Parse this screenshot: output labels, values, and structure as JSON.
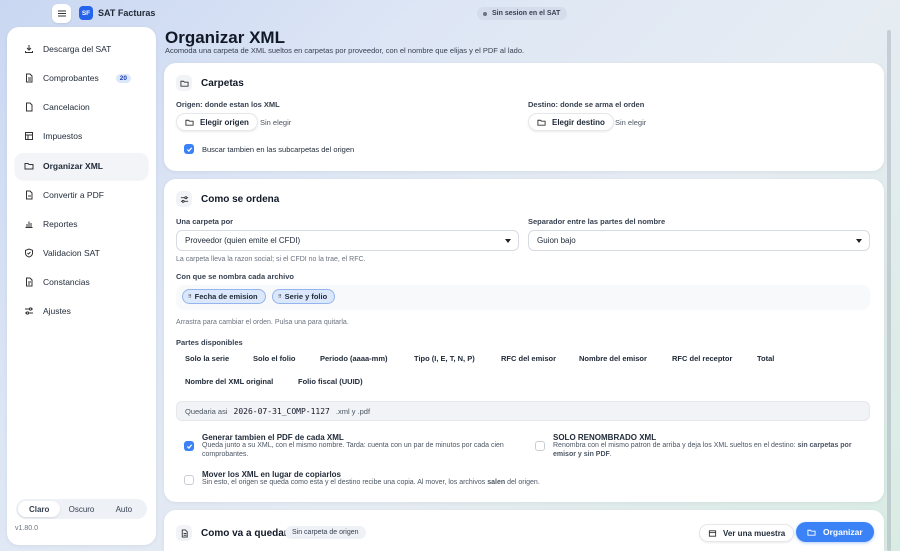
{
  "app": {
    "title": "SAT Facturas",
    "logo": "SF",
    "session": "Sin sesion en el SAT"
  },
  "sidebar": {
    "items": [
      {
        "label": "Descarga del SAT",
        "icon": "download-icon"
      },
      {
        "label": "Comprobantes",
        "icon": "document-icon",
        "badge": "20"
      },
      {
        "label": "Cancelacion",
        "icon": "cancel-icon"
      },
      {
        "label": "Impuestos",
        "icon": "table-icon"
      },
      {
        "label": "Organizar XML",
        "icon": "folder-icon",
        "active": true
      },
      {
        "label": "Convertir a PDF",
        "icon": "file-convert-icon"
      },
      {
        "label": "Reportes",
        "icon": "chart-icon"
      },
      {
        "label": "Validacion SAT",
        "icon": "shield-check-icon"
      },
      {
        "label": "Constancias",
        "icon": "certificate-icon"
      },
      {
        "label": "Ajustes",
        "icon": "sliders-icon"
      }
    ],
    "themes": [
      "Claro",
      "Oscuro",
      "Auto"
    ],
    "theme_selected": "Claro",
    "version": "v1.80.0"
  },
  "page": {
    "title": "Organizar XML",
    "subtitle": "Acomoda una carpeta de XML sueltos en carpetas por proveedor, con el nombre que elijas y el PDF al lado."
  },
  "carpetas": {
    "title": "Carpetas",
    "origen_label": "Origen: donde estan los XML",
    "origen_button": "Elegir origen",
    "origen_value": "Sin elegir",
    "destino_label": "Destino: donde se arma el orden",
    "destino_button": "Elegir destino",
    "destino_value": "Sin elegir",
    "subfolders_label": "Buscar tambien en las subcarpetas del origen",
    "subfolders_checked": true
  },
  "orden": {
    "title": "Como se ordena",
    "carpeta_label": "Una carpeta por",
    "carpeta_value": "Proveedor (quien emite el CFDI)",
    "carpeta_hint": "La carpeta lleva la razon social; si el CFDI no la trae, el RFC.",
    "separador_label": "Separador entre las partes del nombre",
    "separador_value": "Guion bajo",
    "nombre_label": "Con que se nombra cada archivo",
    "chips": [
      "Fecha de emision",
      "Serie y folio"
    ],
    "chips_hint": "Arrastra para cambiar el orden. Pulsa una para quitarla.",
    "partes_label": "Partes disponibles",
    "partes": [
      "Solo la serie",
      "Solo el folio",
      "Periodo (aaaa-mm)",
      "Tipo (I, E, T, N, P)",
      "RFC del emisor",
      "Nombre del emisor",
      "RFC del receptor",
      "Total",
      "Nombre del XML original",
      "Folio fiscal (UUID)"
    ],
    "preview_label": "Quedaria asi",
    "preview_name": "2026-07-31_COMP-1127",
    "preview_ext": ".xml y .pdf",
    "opt_pdf_title": "Generar tambien el PDF de cada XML",
    "opt_pdf_desc": "Queda junto a su XML, con el mismo nombre. Tarda: cuenta con un par de minutos por cada cien comprobantes.",
    "opt_pdf_checked": true,
    "opt_rename_title": "SOLO RENOMBRADO XML",
    "opt_rename_desc": "Renombra con el mismo patron de arriba y deja los XML sueltos en el destino: ",
    "opt_rename_desc_bold": "sin carpetas por emisor y sin PDF",
    "opt_rename_desc_end": ".",
    "opt_rename_checked": false,
    "opt_move_title": "Mover los XML en lugar de copiarlos",
    "opt_move_desc": "Sin esto, el origen se queda como esta y el destino recibe una copia. Al mover, los archivos ",
    "opt_move_desc_bold": "salen",
    "opt_move_desc_end": " del origen.",
    "opt_move_checked": false
  },
  "resultado": {
    "title": "Como va a quedar",
    "tag": "Sin carpeta de origen",
    "preview_button": "Ver una muestra",
    "organize_button": "Organizar"
  },
  "colors": {
    "accent": "#3b82f6",
    "active_badge": "#dbe7fb"
  }
}
